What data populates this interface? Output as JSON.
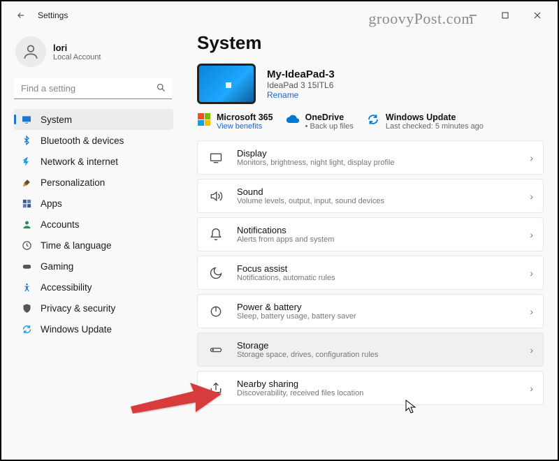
{
  "window": {
    "title": "Settings"
  },
  "watermark": "groovyPost.com",
  "user": {
    "name": "lori",
    "sub": "Local Account"
  },
  "search": {
    "placeholder": "Find a setting"
  },
  "nav": {
    "items": [
      {
        "label": "System"
      },
      {
        "label": "Bluetooth & devices"
      },
      {
        "label": "Network & internet"
      },
      {
        "label": "Personalization"
      },
      {
        "label": "Apps"
      },
      {
        "label": "Accounts"
      },
      {
        "label": "Time & language"
      },
      {
        "label": "Gaming"
      },
      {
        "label": "Accessibility"
      },
      {
        "label": "Privacy & security"
      },
      {
        "label": "Windows Update"
      }
    ]
  },
  "page": {
    "title": "System",
    "device": {
      "name": "My-IdeaPad-3",
      "model": "IdeaPad 3 15ITL6",
      "rename": "Rename"
    },
    "services": {
      "m365": {
        "title": "Microsoft 365",
        "sub": "View benefits"
      },
      "onedrive": {
        "title": "OneDrive",
        "sub": "Back up files"
      },
      "update": {
        "title": "Windows Update",
        "sub": "Last checked: 5 minutes ago"
      }
    },
    "cards": [
      {
        "title": "Display",
        "sub": "Monitors, brightness, night light, display profile"
      },
      {
        "title": "Sound",
        "sub": "Volume levels, output, input, sound devices"
      },
      {
        "title": "Notifications",
        "sub": "Alerts from apps and system"
      },
      {
        "title": "Focus assist",
        "sub": "Notifications, automatic rules"
      },
      {
        "title": "Power & battery",
        "sub": "Sleep, battery usage, battery saver"
      },
      {
        "title": "Storage",
        "sub": "Storage space, drives, configuration rules"
      },
      {
        "title": "Nearby sharing",
        "sub": "Discoverability, received files location"
      }
    ]
  }
}
